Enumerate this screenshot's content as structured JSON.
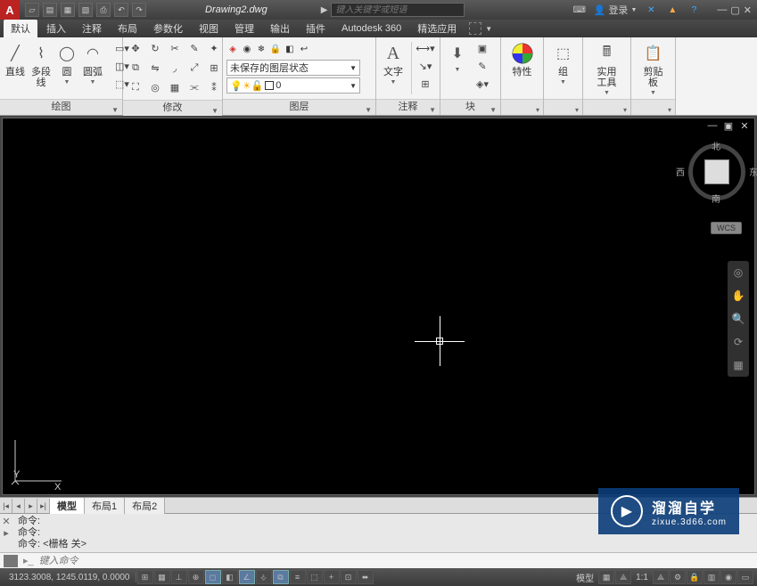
{
  "title": {
    "doc": "Drawing2.dwg",
    "search_ph": "键入关键字或短语",
    "login": "登录"
  },
  "menus": {
    "items": [
      "默认",
      "插入",
      "注释",
      "布局",
      "参数化",
      "视图",
      "管理",
      "输出",
      "插件",
      "Autodesk 360",
      "精选应用"
    ],
    "active": 0
  },
  "ribbon": {
    "draw": {
      "label": "绘图",
      "btns": [
        {
          "l": "直线"
        },
        {
          "l": "多段线"
        },
        {
          "l": "圆"
        },
        {
          "l": "圆弧"
        }
      ]
    },
    "modify": {
      "label": "修改"
    },
    "layer": {
      "label": "图层",
      "combo": "未保存的图层状态",
      "cur": "0"
    },
    "annot": {
      "label": "注释",
      "t": "文字"
    },
    "block": {
      "label": "块"
    },
    "props": {
      "label": "特性"
    },
    "group": {
      "label": "组"
    },
    "util": {
      "label": "实用工具"
    },
    "clip": {
      "label": "剪贴板"
    }
  },
  "viewcube": {
    "n": "北",
    "s": "南",
    "e": "东",
    "w": "西",
    "wcs": "WCS"
  },
  "layouttabs": {
    "model": "模型",
    "l1": "布局1",
    "l2": "布局2"
  },
  "cmd": {
    "p1": "命令:",
    "p2": "命令:",
    "p3": "命令:  <栅格 关>",
    "ph": "键入命令"
  },
  "status": {
    "coords": "3123.3008, 1245.0119, 0.0000",
    "model": "模型",
    "scale": "1:1"
  },
  "watermark": {
    "t1": "溜溜自学",
    "t2": "zixue.3d66.com"
  }
}
